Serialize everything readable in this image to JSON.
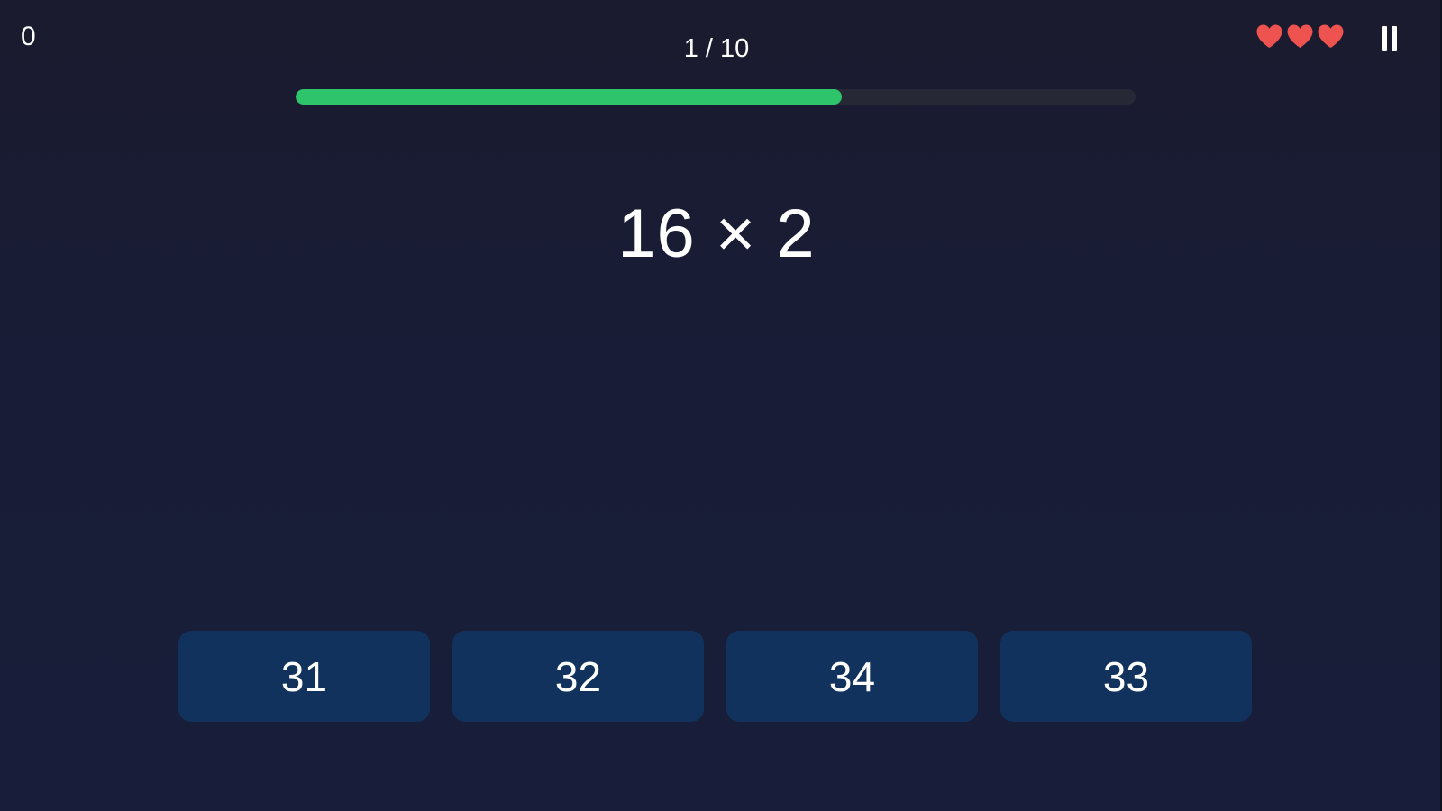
{
  "hud": {
    "score": "0",
    "question_counter": "1 / 10",
    "progress_fraction": 0.65,
    "lives": 3,
    "heart_color": "#ef5350",
    "progress_color": "#2ec46c"
  },
  "question": {
    "text": "16 × 2"
  },
  "answers": [
    {
      "label": "31"
    },
    {
      "label": "32"
    },
    {
      "label": "34"
    },
    {
      "label": "33"
    }
  ],
  "icons": {
    "life": "heart-icon",
    "pause": "pause-icon"
  }
}
